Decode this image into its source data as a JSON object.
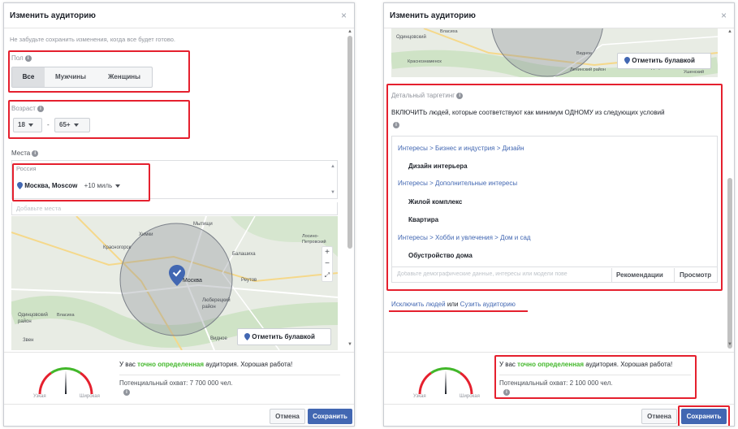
{
  "left": {
    "title": "Изменить аудиторию",
    "close": "×",
    "reminder": "Не забудьте сохранить изменения, когда все будет готово.",
    "gender": {
      "label": "Пол",
      "options": [
        "Все",
        "Мужчины",
        "Женщины"
      ],
      "selected": "Все"
    },
    "age": {
      "label": "Возраст",
      "from": "18",
      "dash": "-",
      "to": "65+"
    },
    "places": {
      "label": "Места",
      "country": "Россия",
      "location": "Москва, Moscow",
      "radius": "+10 миль",
      "add_placeholder": "Добавьте места"
    },
    "map": {
      "pin_button": "Отметить булавкой",
      "labels": [
        "Мытищи",
        "Химки",
        "Лосино-Петровский",
        "Красногорск",
        "Балашиха",
        "Москва",
        "Реутов",
        "Люберецкий район",
        "Одинцовский район",
        "Власиха",
        "Видное",
        "Звен"
      ],
      "zoom_in": "+",
      "zoom_out": "−",
      "expand": "⤢"
    },
    "gauge": {
      "narrow": "Узкая",
      "wide": "Широкая"
    },
    "status": {
      "prefix": "У вас ",
      "highlight": "точно определенная",
      "suffix": " аудитория. Хорошая работа!"
    },
    "reach": "Потенциальный охват: 7 700 000 чел.",
    "cancel": "Отмена",
    "save": "Сохранить"
  },
  "right": {
    "title": "Изменить аудиторию",
    "close": "×",
    "map": {
      "pin_button": "Отметить булавкой",
      "labels": [
        "Одинцовский",
        "Власиха",
        "Краснознаменск",
        "Видное",
        "Ленинский район",
        "Дзержинский",
        "Ушенский"
      ]
    },
    "detailed": {
      "label": "Детальный таргетинг",
      "include_text": "ВКЛЮЧИТЬ людей, которые соответствуют как минимум ОДНОМУ из следующих условий",
      "items": [
        {
          "kind": "path",
          "text": "Интересы > Бизнес и индустрия > Дизайн"
        },
        {
          "kind": "item",
          "text": "Дизайн интерьера"
        },
        {
          "kind": "path",
          "text": "Интересы > Дополнительные интересы"
        },
        {
          "kind": "item",
          "text": "Жилой комплекс"
        },
        {
          "kind": "item",
          "text": "Квартира"
        },
        {
          "kind": "path",
          "text": "Интересы > Хобби и увлечения > Дом и сад"
        },
        {
          "kind": "item",
          "text": "Обустройство дома"
        }
      ],
      "input_placeholder": "Добавьте демографические данные, интересы или модели пове",
      "recommendations": "Рекомендации",
      "browse": "Просмотр"
    },
    "exclude_link": "Исключить людей",
    "or_text": " или ",
    "narrow_link": "Сузить аудиторию",
    "gauge": {
      "narrow": "Узкая",
      "wide": "Широкая"
    },
    "status": {
      "prefix": "У вас ",
      "highlight": "точно определенная",
      "suffix": " аудитория. Хорошая работа!"
    },
    "reach": "Потенциальный охват: 2 100 000 чел.",
    "cancel": "Отмена",
    "save": "Сохранить"
  },
  "colors": {
    "accent": "#4267b2",
    "highlight_red": "#e5202e",
    "good_green": "#42b72a"
  }
}
